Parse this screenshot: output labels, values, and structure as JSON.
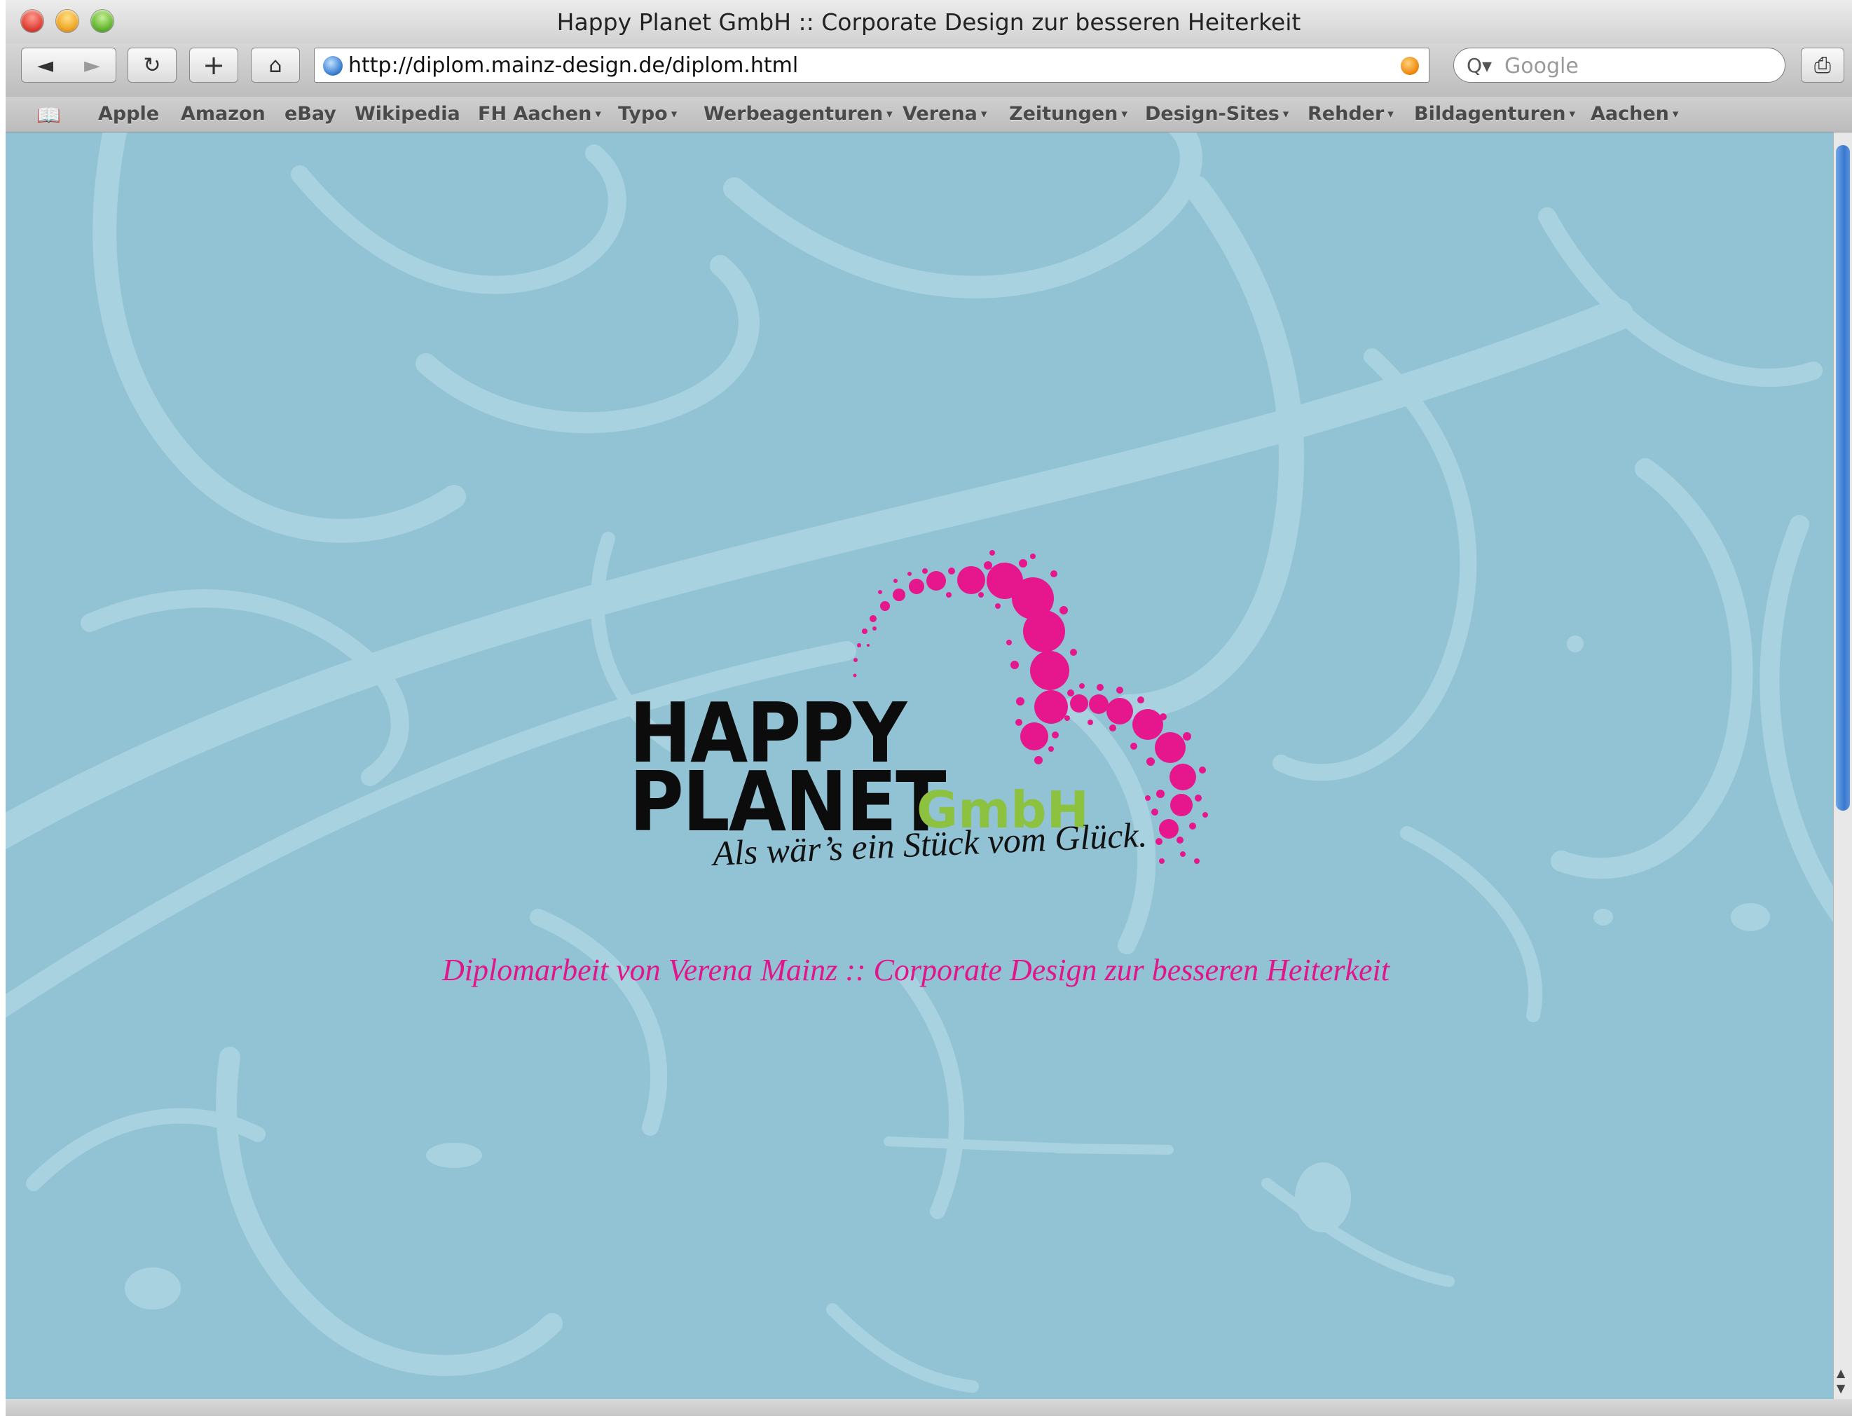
{
  "window": {
    "title": "Happy Planet GmbH :: Corporate Design zur besseren Heiterkeit"
  },
  "toolbar": {
    "back_icon": "◄",
    "forward_icon": "►",
    "reload_icon": "↻",
    "add_icon": "+",
    "home_icon": "⌂",
    "url": "http://diplom.mainz-design.de/diplom.html",
    "search_placeholder": "Google",
    "search_icon": "Q▾",
    "print_icon": "⎙"
  },
  "bookmarks": {
    "icon": "📖",
    "items": [
      {
        "label": "Apple",
        "menu": false
      },
      {
        "label": "Amazon",
        "menu": false
      },
      {
        "label": "eBay",
        "menu": false
      },
      {
        "label": "Wikipedia",
        "menu": false
      },
      {
        "label": "FH Aachen",
        "menu": true
      },
      {
        "label": "Typo",
        "menu": true
      },
      {
        "label": "Werbeagenturen",
        "menu": true
      },
      {
        "label": "Verena",
        "menu": true
      },
      {
        "label": "Zeitungen",
        "menu": true
      },
      {
        "label": "Design-Sites",
        "menu": true
      },
      {
        "label": "Rehder",
        "menu": true
      },
      {
        "label": "Bildagenturen",
        "menu": true
      },
      {
        "label": "Aachen",
        "menu": true
      }
    ],
    "arrow": "▾"
  },
  "page": {
    "logo_line1": "HAPPY",
    "logo_line2": "PLANET",
    "logo_gmbh": "GmbH",
    "tagline": "Als wär’s ein Stück vom Glück.",
    "subtitle": "Diplomarbeit von Verena Mainz  ::  Corporate Design zur besseren Heiterkeit"
  },
  "scrollbar": {
    "up_arrow": "▲",
    "down_arrow": "▼"
  },
  "colors": {
    "background": "#92c3d5",
    "ornament": "#a9d2e0",
    "logo_pink": "#e6168c",
    "logo_green": "#8cc23f",
    "logo_black": "#0c0c0c"
  }
}
